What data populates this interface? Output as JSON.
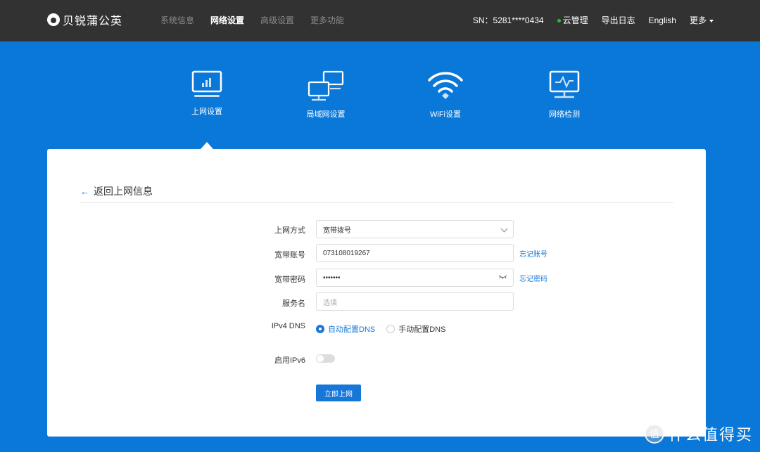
{
  "header": {
    "brand": "贝锐蒲公英",
    "nav": [
      {
        "label": "系统信息",
        "active": false
      },
      {
        "label": "网络设置",
        "active": true
      },
      {
        "label": "高级设置",
        "active": false
      },
      {
        "label": "更多功能",
        "active": false
      }
    ],
    "sn": "SN：5281****0434",
    "cloud": "云管理",
    "cloud_status_color": "#22c32a",
    "export_log": "导出日志",
    "language": "English",
    "more": "更多"
  },
  "categories": [
    {
      "label": "上网设置",
      "icon": "monitor-chart-icon",
      "active": true
    },
    {
      "label": "局域网设置",
      "icon": "lan-monitors-icon",
      "active": false
    },
    {
      "label": "WiFi设置",
      "icon": "wifi-icon",
      "active": false
    },
    {
      "label": "网络检测",
      "icon": "network-monitor-icon",
      "active": false
    }
  ],
  "card": {
    "back_label": "返回上网信息",
    "form": {
      "connection_type": {
        "label": "上网方式",
        "value": "宽带拨号"
      },
      "account": {
        "label": "宽带账号",
        "value": "073108019267",
        "link": "忘记账号"
      },
      "password": {
        "label": "宽带密码",
        "value": "•••••••",
        "link": "忘记密码"
      },
      "service": {
        "label": "服务名",
        "placeholder": "选填"
      },
      "dns": {
        "label": "IPv4 DNS",
        "options": [
          {
            "label": "自动配置DNS",
            "checked": true
          },
          {
            "label": "手动配置DNS",
            "checked": false
          }
        ]
      },
      "ipv6": {
        "label": "启用IPv6",
        "enabled": false
      },
      "submit": "立即上网"
    }
  },
  "colors": {
    "accent": "#1677d8",
    "background": "#0a78d8",
    "topbar": "#323232"
  },
  "watermark": {
    "badge": "值",
    "text": "什么值得买"
  }
}
